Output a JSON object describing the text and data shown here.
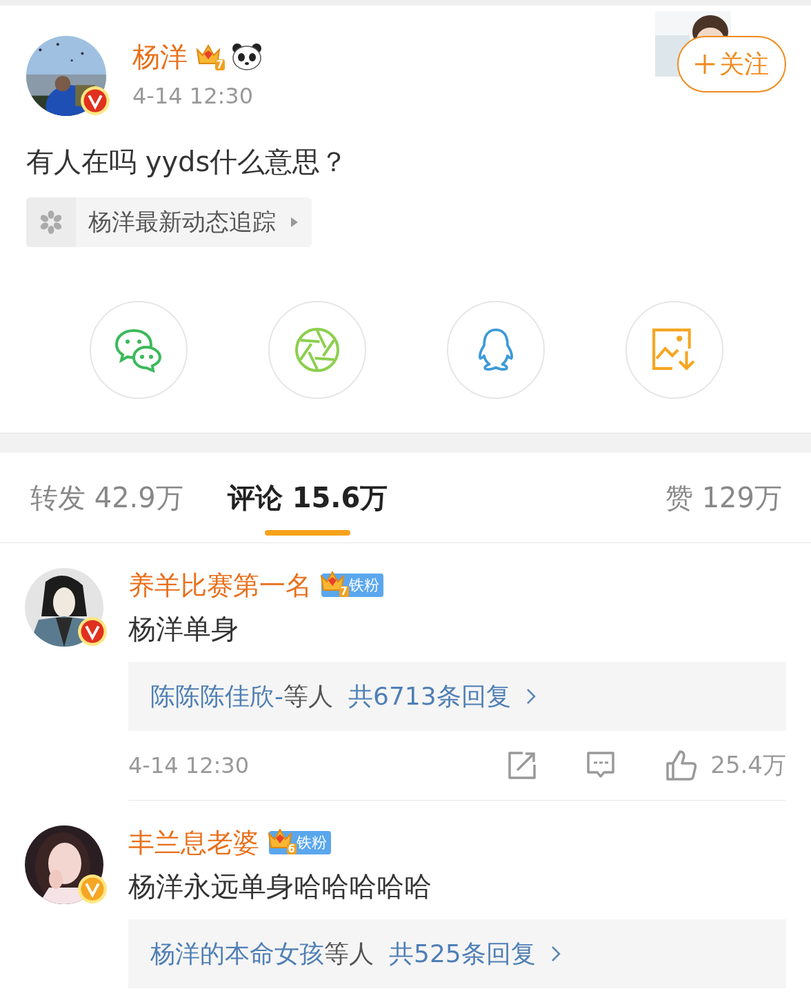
{
  "post": {
    "author": {
      "name": "杨洋",
      "fan_level": "7",
      "verified": true,
      "color": "#e0301e"
    },
    "time": "4-14 12:30",
    "text": "有人在吗 yyds什么意思？",
    "topic": "杨洋最新动态追踪",
    "follow": {
      "label": "关注"
    },
    "share": [
      {
        "kind": "wechat"
      },
      {
        "kind": "moments"
      },
      {
        "kind": "qq"
      },
      {
        "kind": "save_image"
      }
    ]
  },
  "tabs": [
    {
      "label": "转发 42.9万",
      "selected": false
    },
    {
      "label": "评论 15.6万",
      "selected": true
    },
    {
      "label": "赞 129万",
      "selected": false
    }
  ],
  "comments": [
    {
      "name": "养羊比赛第一名",
      "fan_level": "7",
      "fan_badge": "铁粉",
      "verified": true,
      "color": "#e0301e",
      "text": "杨洋单身",
      "replies": {
        "names": "陈陈陈佳欣-",
        "suffix": "等人",
        "count": "共6713条回复"
      },
      "time": "4-14 12:30",
      "likes": "25.4万"
    },
    {
      "name": "丰兰息老婆",
      "fan_level": "6",
      "fan_badge": "铁粉",
      "verified": true,
      "color": "#f5a623",
      "text": "杨洋永远单身哈哈哈哈哈",
      "replies": {
        "names": "杨洋的本命女孩",
        "suffix": "等人",
        "count": "共525条回复"
      }
    }
  ]
}
